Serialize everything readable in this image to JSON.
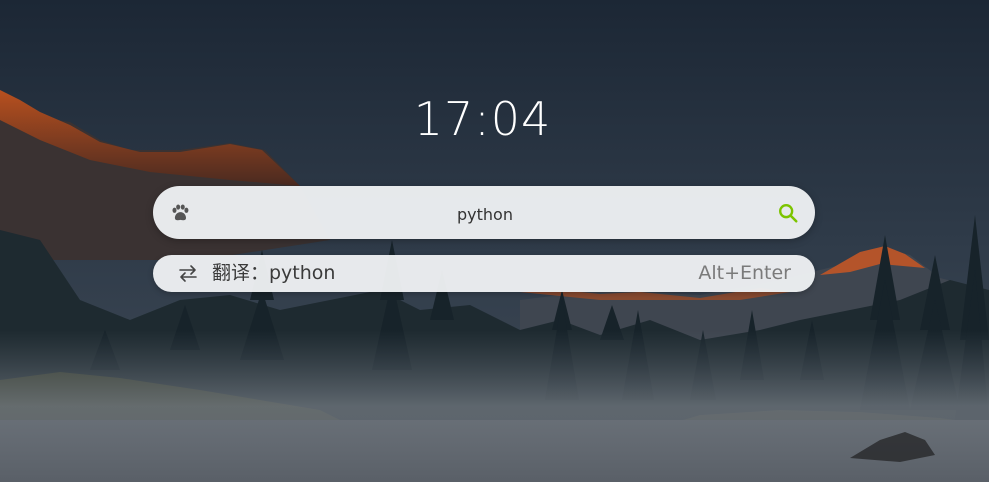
{
  "clock": {
    "time": "17:04"
  },
  "search": {
    "value": "python",
    "left_icon": "paw-icon",
    "right_icon": "search-icon",
    "accent_color": "#7cc400"
  },
  "suggestion": {
    "icon": "swap-arrows-icon",
    "label": "翻译：python",
    "shortcut": "Alt+Enter"
  },
  "wallpaper": {
    "description_icon": "mountain-lake-forest-wallpaper"
  }
}
